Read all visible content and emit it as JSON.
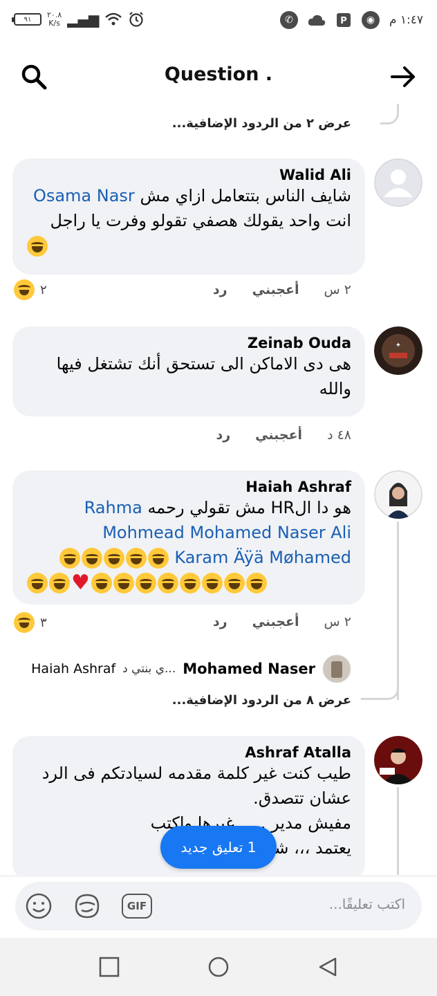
{
  "status_bar": {
    "battery": "٩١",
    "net_speed": "٢٠.٨",
    "net_unit": "K/s",
    "time": "١:٤٧ م"
  },
  "header": {
    "title": "Question ."
  },
  "top_more_replies": "عرض ٢ من الردود الإضافية...",
  "comments": [
    {
      "name": "Walid Ali",
      "text_line1": "شايف الناس بتتعامل ازاي مش",
      "mention1": "Osama Nasr",
      "text_line2": "انت  واحد يقولك هصفي تقولو وفرت يا راجل",
      "time": "٢ س",
      "like": "أعجبني",
      "reply": "رد",
      "reactions": "٢"
    },
    {
      "name": "Zeinab Ouda",
      "text": "هى دى الاماكن الى تستحق أنك تشتغل فيها والله",
      "time": "٤٨ د",
      "like": "أعجبني",
      "reply": "رد"
    },
    {
      "name": "Haiah Ashraf",
      "text_line1": "هو دا الHR مش تقولي رحمه",
      "mention1": "Rahma",
      "mention2": "Mohmead Mohamed Naser Ali",
      "mention3": "Karam Äÿä Møhamed",
      "time": "٢ س",
      "like": "أعجبني",
      "reply": "رد",
      "reactions": "٣"
    },
    {
      "name": "Ashraf Atalla",
      "text_line1": "طيب كنت غير كلمة مقدمه لسيادتكم فى الرد",
      "text_line2": "عشان تتصدق.",
      "text_line3": "مفيش مدير ... . غيرها واكتب",
      "text_line4": "يعتمد ،،، شكرا"
    }
  ],
  "reply_preview": {
    "name": "Mohamed Naser",
    "snippet": "ي بنتي د...",
    "tagged": "Haiah Ashraf"
  },
  "mid_more_replies": "عرض ٨ من الردود الإضافية...",
  "toast": "1 تعليق جديد",
  "composer": {
    "placeholder": "اكتب تعليقًا...",
    "gif_label": "GIF"
  }
}
